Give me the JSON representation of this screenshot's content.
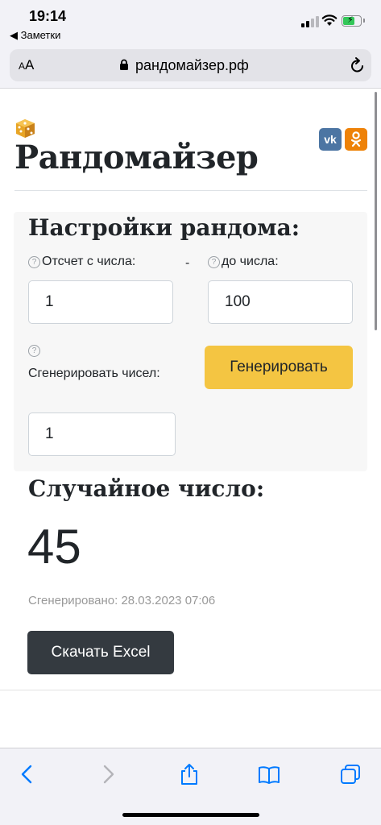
{
  "status_bar": {
    "time": "19:14",
    "back_app": "◀ Заметки"
  },
  "browser": {
    "aa_label_small": "A",
    "aa_label_big": "A",
    "url": "рандомайзер.рф"
  },
  "site": {
    "title": "Рандомайзер",
    "social": {
      "vk": "vk"
    }
  },
  "settings": {
    "title": "Настройки рандома:",
    "help_icon": "?",
    "from_label": "Отсчет с числа:",
    "separator": "-",
    "to_label": "до числа:",
    "from_value": "1",
    "to_value": "100",
    "count_label": "Сгенерировать чисел:",
    "count_value": "1",
    "generate_label": "Генерировать"
  },
  "result": {
    "title": "Случайное число:",
    "value": "45",
    "generated_at": "Сгенерировано: 28.03.2023 07:06",
    "download_label": "Скачать Excel"
  },
  "colors": {
    "accent_yellow": "#f4c542",
    "dark_button": "#343a40",
    "vk_blue": "#4c75a3",
    "ok_orange": "#ee8208",
    "ios_blue": "#007aff"
  }
}
